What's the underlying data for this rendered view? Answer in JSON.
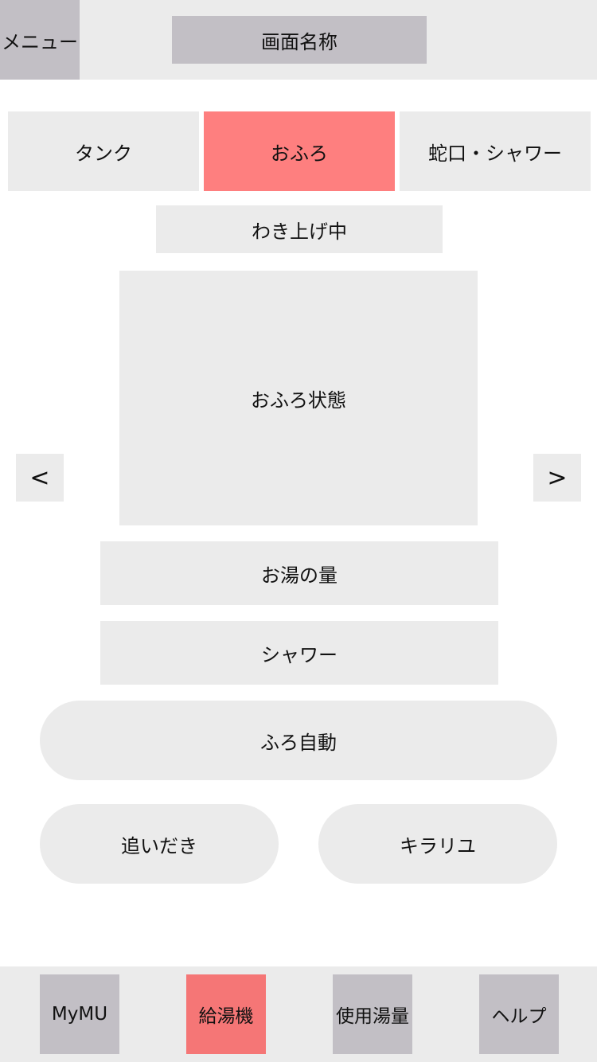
{
  "header": {
    "menu_label": "メニュー",
    "screen_title": "画面名称"
  },
  "tabs": [
    {
      "label": "タンク",
      "active": false
    },
    {
      "label": "おふろ",
      "active": true
    },
    {
      "label": "蛇口・シャワー",
      "active": false
    }
  ],
  "status": {
    "label": "わき上げ中"
  },
  "panel": {
    "bath_state": "おふろ状態",
    "prev_label": "<",
    "next_label": ">"
  },
  "info": {
    "water_amount": "お湯の量",
    "shower": "シャワー"
  },
  "actions": {
    "auto_bath": "ふろ自動",
    "reheat": "追いだき",
    "kirari": "キラリユ"
  },
  "footer": {
    "items": [
      {
        "label": "MyMU",
        "active": false
      },
      {
        "label": "給湯機",
        "active": true
      },
      {
        "label": "使用湯量",
        "active": false
      },
      {
        "label": "ヘルプ",
        "active": false
      }
    ]
  },
  "colors": {
    "active": "#fe7f7f",
    "active_nav": "#f57676",
    "panel": "#ebebeb",
    "nav_button": "#c2bfc5"
  }
}
